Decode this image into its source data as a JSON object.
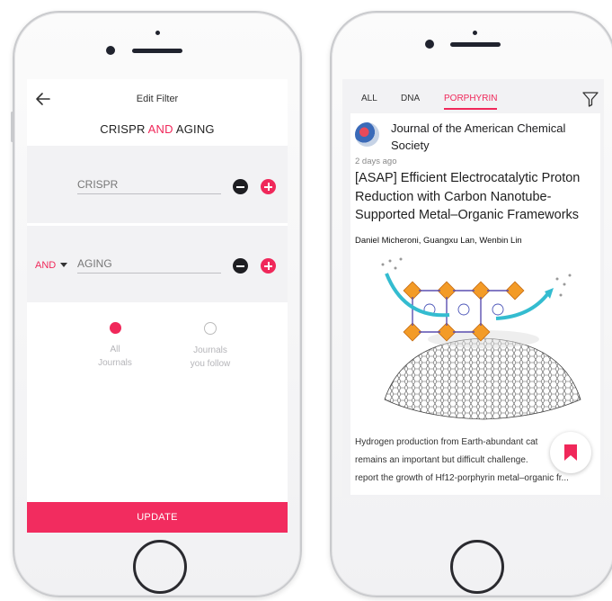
{
  "edit_filter": {
    "title": "Edit Filter",
    "query": {
      "term1": "CRISPR",
      "operator": "AND",
      "term2": "AGING"
    },
    "rows": [
      {
        "term": "CRISPR"
      },
      {
        "operator": "AND",
        "term": "AGING"
      }
    ],
    "scope_options": [
      {
        "label_line1": "All",
        "label_line2": "Journals",
        "selected": true
      },
      {
        "label_line1": "Journals",
        "label_line2": "you follow",
        "selected": false
      }
    ],
    "update_label": "UPDATE"
  },
  "feed": {
    "tabs": [
      {
        "label": "ALL",
        "active": false
      },
      {
        "label": "DNA",
        "active": false
      },
      {
        "label": "PORPHYRIN",
        "active": true
      }
    ],
    "article": {
      "journal": "Journal of the American Chemical Society",
      "time": "2 days ago",
      "title": "[ASAP] Efficient Electrocatalytic Proton Reduction with Carbon Nanotube-Supported Metal–Organic Frameworks",
      "authors": "Daniel Micheroni, Guangxu Lan, Wenbin Lin",
      "abstract_lines": [
        "Hydrogen production from Earth-abundant cat",
        "remains an important but difficult challenge.",
        "report the growth of Hf12-porphyrin metal–organic fr..."
      ]
    },
    "nav_icons": [
      "home-icon",
      "feed-icon",
      "fire-icon",
      "bookmark-icon",
      "profile-icon"
    ]
  },
  "colors": {
    "accent": "#f0285a",
    "background": "#f2f2f4"
  }
}
